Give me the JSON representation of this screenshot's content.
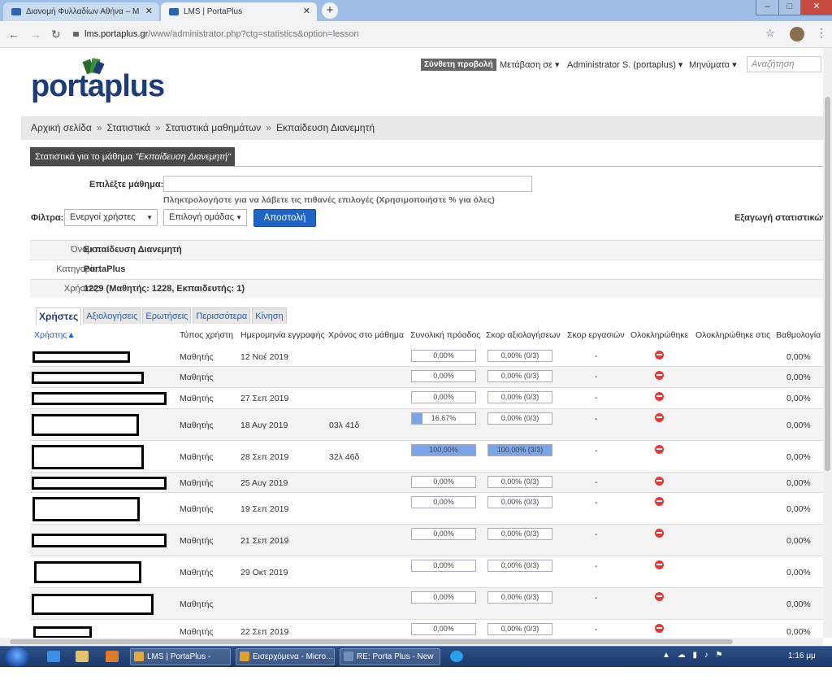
{
  "browser": {
    "tabs": [
      {
        "title": "Διανομή Φυλλαδίων Αθήνα – Μ"
      },
      {
        "title": "LMS | PortaPlus"
      }
    ],
    "url_host": "lms.portaplus.gr",
    "url_path": "/www/administrator.php?ctg=statistics&option=lesson"
  },
  "site": {
    "logo": "portaplus",
    "compose": "Σύνθετη προβολή",
    "nav": [
      "Μετάβαση σε ▾",
      "Administrator S. (portaplus) ▾",
      "Μηνύματα ▾"
    ],
    "search_placeholder": "Αναζήτηση"
  },
  "breadcrumb": [
    "Αρχική σελίδα",
    "Στατιστικά",
    "Στατιστικά μαθημάτων",
    "Εκπαίδευση Διανεμητή"
  ],
  "panel": {
    "title_prefix": "Στατιστικά για το μάθημα ",
    "title_lesson": "\"Εκπαίδευση Διανεμητή\""
  },
  "form": {
    "lesson_label": "Επιλέξτε μάθημα:",
    "hint": "Πληκτρολογήστε για να λάβετε τις πιθανές επιλογές (Χρησιμοποιήστε % για όλες)",
    "filter_label": "Φίλτρα:",
    "filter_value": "Ενεργοί χρήστες",
    "group_value": "Επιλογή ομάδας",
    "submit": "Αποστολή",
    "export": "Εξαγωγή στατιστικών"
  },
  "info": [
    {
      "key": "Όνομα:",
      "value": "Εκπαίδευση Διανεμητή"
    },
    {
      "key": "Κατηγορία:",
      "value": "PortaPlus"
    },
    {
      "key": "Χρήστες:",
      "value": "1229 (Μαθητής: 1228, Εκπαιδευτής: 1)"
    }
  ],
  "tabs": [
    "Χρήστες",
    "Αξιολογήσεις",
    "Ερωτήσεις",
    "Περισσότερα",
    "Κίνηση"
  ],
  "columns": [
    "Χρήστης",
    "Τύπος χρήστη",
    "Ημερομηνία εγγραφής",
    "Χρόνος στο μάθημα",
    "Συνολική πρόοδος",
    "Σκορ αξιολογήσεων",
    "Σκορ εργασιών",
    "Ολοκληρώθηκε",
    "Ολοκληρώθηκε στις",
    "Βαθμολογία"
  ],
  "rows": [
    {
      "type": "Μαθητής",
      "date": "12 Νοέ 2019",
      "time": "",
      "progress": "0,00%",
      "progress_value": 0,
      "score": "0,00% (0/3)",
      "score_value": 0,
      "tasks": "-",
      "grade": "0,00%"
    },
    {
      "type": "Μαθητής",
      "date": "",
      "time": "",
      "progress": "0,00%",
      "progress_value": 0,
      "score": "0,00% (0/3)",
      "score_value": 0,
      "tasks": "-",
      "grade": "0,00%"
    },
    {
      "type": "Μαθητής",
      "date": "27 Σεπ 2019",
      "time": "",
      "progress": "0,00%",
      "progress_value": 0,
      "score": "0,00% (0/3)",
      "score_value": 0,
      "tasks": "-",
      "grade": "0,00%"
    },
    {
      "type": "Μαθητής",
      "date": "18 Αυγ 2019",
      "time": "03λ 41δ",
      "progress": "16,67%",
      "progress_value": 16.67,
      "score": "0,00% (0/3)",
      "score_value": 0,
      "tasks": "-",
      "grade": "0,00%"
    },
    {
      "type": "Μαθητής",
      "date": "28 Σεπ 2019",
      "time": "32λ 46δ",
      "progress": "100,00%",
      "progress_value": 100,
      "score": "100,00% (3/3)",
      "score_value": 100,
      "tasks": "-",
      "grade": "0,00%"
    },
    {
      "type": "Μαθητής",
      "date": "25 Αυγ 2019",
      "time": "",
      "progress": "0,00%",
      "progress_value": 0,
      "score": "0,00% (0/3)",
      "score_value": 0,
      "tasks": "-",
      "grade": "0,00%"
    },
    {
      "type": "Μαθητής",
      "date": "19 Σεπ 2019",
      "time": "",
      "progress": "0,00%",
      "progress_value": 0,
      "score": "0,00% (0/3)",
      "score_value": 0,
      "tasks": "-",
      "grade": "0,00%"
    },
    {
      "type": "Μαθητής",
      "date": "21 Σεπ 2019",
      "time": "",
      "progress": "0,00%",
      "progress_value": 0,
      "score": "0,00% (0/3)",
      "score_value": 0,
      "tasks": "-",
      "grade": "0,00%"
    },
    {
      "type": "Μαθητής",
      "date": "29 Οκτ 2019",
      "time": "",
      "progress": "0,00%",
      "progress_value": 0,
      "score": "0,00% (0/3)",
      "score_value": 0,
      "tasks": "-",
      "grade": "0,00%"
    },
    {
      "type": "Μαθητής",
      "date": "",
      "time": "",
      "progress": "0,00%",
      "progress_value": 0,
      "score": "0,00% (0/3)",
      "score_value": 0,
      "tasks": "-",
      "grade": "0,00%"
    },
    {
      "type": "Μαθητής",
      "date": "22 Σεπ 2019",
      "time": "",
      "progress": "0,00%",
      "progress_value": 0,
      "score": "0,00% (0/3)",
      "score_value": 0,
      "tasks": "-",
      "grade": "0,00%"
    }
  ],
  "taskbar": {
    "tasks": [
      "LMS | PortaPlus - Go...",
      "Εισερχόμενα - Micro...",
      "RE: Porta Plus - New ..."
    ],
    "clock": "1:16 μμ"
  }
}
